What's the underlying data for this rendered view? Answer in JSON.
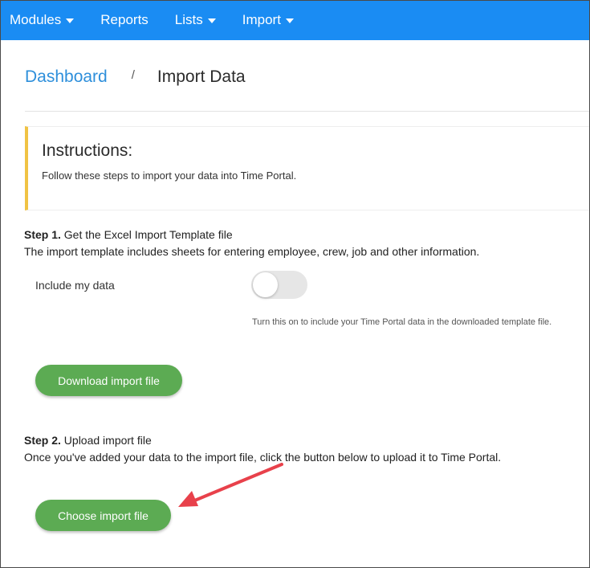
{
  "navbar": {
    "items": [
      {
        "label": "Modules",
        "dropdown": true
      },
      {
        "label": "Reports",
        "dropdown": false
      },
      {
        "label": "Lists",
        "dropdown": true
      },
      {
        "label": "Import",
        "dropdown": true
      }
    ],
    "color": "#1a8cf3"
  },
  "breadcrumb": {
    "home": "Dashboard",
    "separator": "/",
    "current": "Import Data"
  },
  "instructions": {
    "title": "Instructions:",
    "text": "Follow these steps to import your data into Time Portal."
  },
  "step1": {
    "label": "Step 1.",
    "title": "Get the Excel Import Template file",
    "description": "The import template includes sheets for entering employee, crew, job and other information.",
    "toggle_label": "Include my data",
    "toggle_on": false,
    "toggle_help": "Turn this on to include your Time Portal data in the downloaded template file.",
    "button_label": "Download import file"
  },
  "step2": {
    "label": "Step 2.",
    "title": "Upload import file",
    "description": "Once you've added your data to the import file, click the button below to upload it to Time Portal.",
    "button_label": "Choose import file"
  },
  "colors": {
    "accent": "#1a8cf3",
    "button": "#5cab53",
    "callout_border": "#f0c344",
    "annotation_arrow": "#e8414b"
  }
}
